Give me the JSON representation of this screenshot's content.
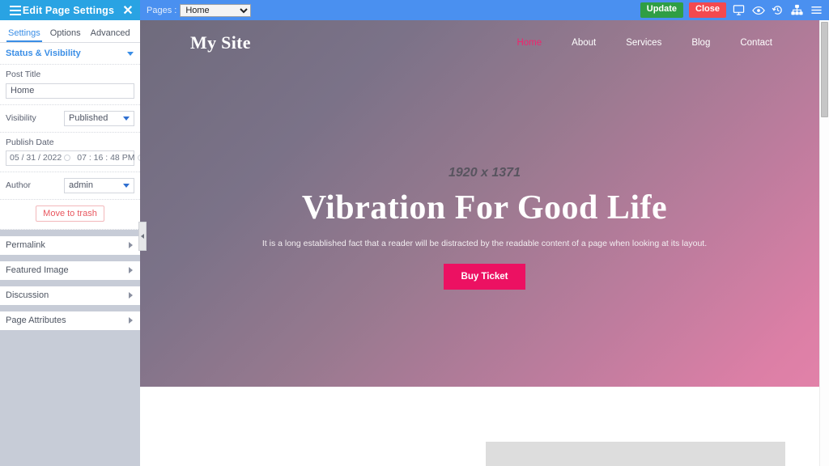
{
  "topbar": {
    "menu_icon": "hamburger-icon",
    "title": "Edit Page Settings",
    "close_icon": "close-x-icon",
    "pages_label": "Pages :",
    "pages_selected": "Home",
    "pages_options": [
      "Home"
    ],
    "update_label": "Update",
    "close_label": "Close",
    "icons": [
      {
        "name": "desktop-preview-icon",
        "glyph": "monitor"
      },
      {
        "name": "eye-preview-icon",
        "glyph": "eye"
      },
      {
        "name": "revision-history-icon",
        "glyph": "history"
      },
      {
        "name": "sitemap-icon",
        "glyph": "sitemap"
      },
      {
        "name": "menu-icon",
        "glyph": "hamburger"
      }
    ],
    "colors": {
      "left_bg": "#29a3e3",
      "right_bg": "#4a90f0",
      "update": "#2f9e44",
      "close": "#f4494f"
    }
  },
  "sidebar": {
    "tabs": [
      {
        "label": "Settings",
        "active": true
      },
      {
        "label": "Options",
        "active": false
      },
      {
        "label": "Advanced",
        "active": false
      }
    ],
    "status_visibility": {
      "header": "Status & Visibility",
      "post_title_label": "Post Title",
      "post_title_value": "Home",
      "post_title_placeholder": "Post Title",
      "visibility_label": "Visibility",
      "visibility_value": "Published",
      "publish_date_label": "Publish Date",
      "publish_date_value": "05 / 31 / 2022",
      "publish_time_value": "07 : 16 : 48",
      "publish_meridiem": "PM",
      "author_label": "Author",
      "author_value": "admin",
      "trash_label": "Move to trash"
    },
    "accordions": [
      {
        "label": "Permalink"
      },
      {
        "label": "Featured Image"
      },
      {
        "label": "Discussion"
      },
      {
        "label": "Page Attributes"
      }
    ],
    "collapse_handle_icon": "chevron-left-icon"
  },
  "preview": {
    "site_logo": "My Site",
    "nav": [
      {
        "label": "Home",
        "active": true
      },
      {
        "label": "About",
        "active": false
      },
      {
        "label": "Services",
        "active": false
      },
      {
        "label": "Blog",
        "active": false
      },
      {
        "label": "Contact",
        "active": false
      }
    ],
    "hero": {
      "dimensions": "1920 x 1371",
      "title": "Vibration For Good Life",
      "subtitle": "It is a long established fact that a reader will be distracted by the readable content of a page when looking at its layout.",
      "cta_label": "Buy Ticket"
    },
    "colors": {
      "hero_start": "#6f6b7d",
      "hero_end": "#e282a9",
      "accent_pink": "#ec1162",
      "nav_active": "#f0246e"
    }
  }
}
